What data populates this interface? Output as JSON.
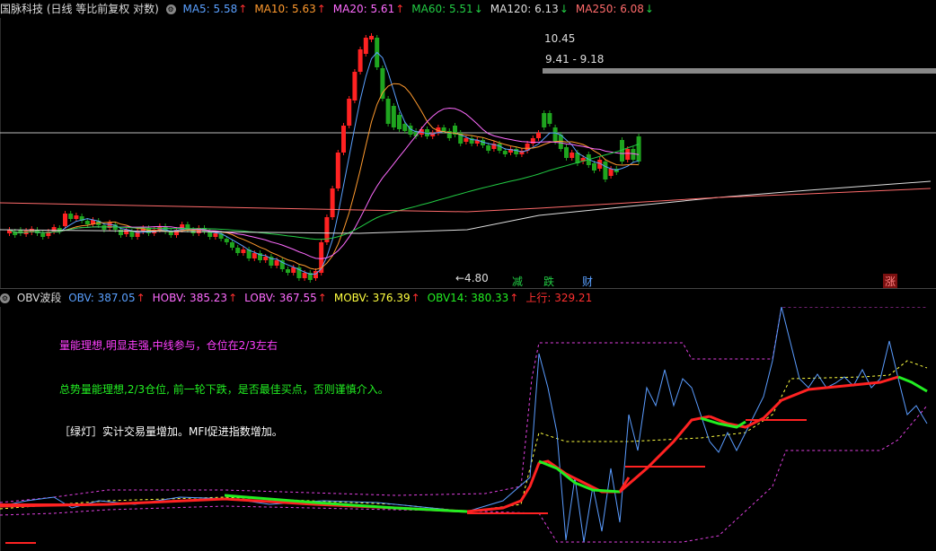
{
  "header": {
    "title": "国脉科技 (日线 等比前复权 对数)",
    "mas": [
      {
        "label": "MA5: 5.58",
        "arrow": "↑",
        "color": "#5aa0ff"
      },
      {
        "label": "MA10: 5.63",
        "arrow": "↑",
        "color": "#ff9a2e"
      },
      {
        "label": "MA20: 5.61",
        "arrow": "↑",
        "color": "#ff6bff"
      },
      {
        "label": "MA60: 5.51",
        "arrow": "↓",
        "color": "#22cc44"
      },
      {
        "label": "MA120: 6.13",
        "arrow": "↓",
        "color": "#dddddd"
      },
      {
        "label": "MA250: 6.08",
        "arrow": "↓",
        "color": "#ff6b6b"
      }
    ]
  },
  "price_annotations": {
    "high": "10.45",
    "range": "9.41 - 9.18",
    "low": "4.80"
  },
  "events": [
    {
      "label": "减",
      "color": "#22cc44"
    },
    {
      "label": "跌",
      "color": "#22cc44"
    },
    {
      "label": "财",
      "color": "#5aa0ff"
    },
    {
      "label": "涨",
      "color": "#ff8080",
      "bg": "#7a1010"
    }
  ],
  "indicator": {
    "name": "OBV波段",
    "values": [
      {
        "label": "OBV: 387.05",
        "arrow": "↑",
        "color": "#5aa0ff"
      },
      {
        "label": "HOBV: 385.23",
        "arrow": "↑",
        "color": "#ff6bff"
      },
      {
        "label": "LOBV: 367.55",
        "arrow": "↑",
        "color": "#ff6bff"
      },
      {
        "label": "MOBV: 376.39",
        "arrow": "↑",
        "color": "#ffff40"
      },
      {
        "label": "OBV14: 380.33",
        "arrow": "↑",
        "color": "#22ee22"
      },
      {
        "label": "上行: 329.21",
        "arrow": "",
        "color": "#ff3030"
      }
    ]
  },
  "notes": [
    {
      "text": "量能理想,明显走强,中线参与，仓位在2/3左右",
      "color": "#ff40ff"
    },
    {
      "text": "总势量能理想,2/3仓位, 前一轮下跌，是否最佳买点，否则谨慎介入。",
      "color": "#22ee22"
    },
    {
      "text": "［绿灯］实计交易量增加。MFI促进指数增加。",
      "color": "#ffffff"
    }
  ],
  "colors": {
    "up": "#ff2222",
    "down": "#1fa51f",
    "bg": "#000000"
  }
}
